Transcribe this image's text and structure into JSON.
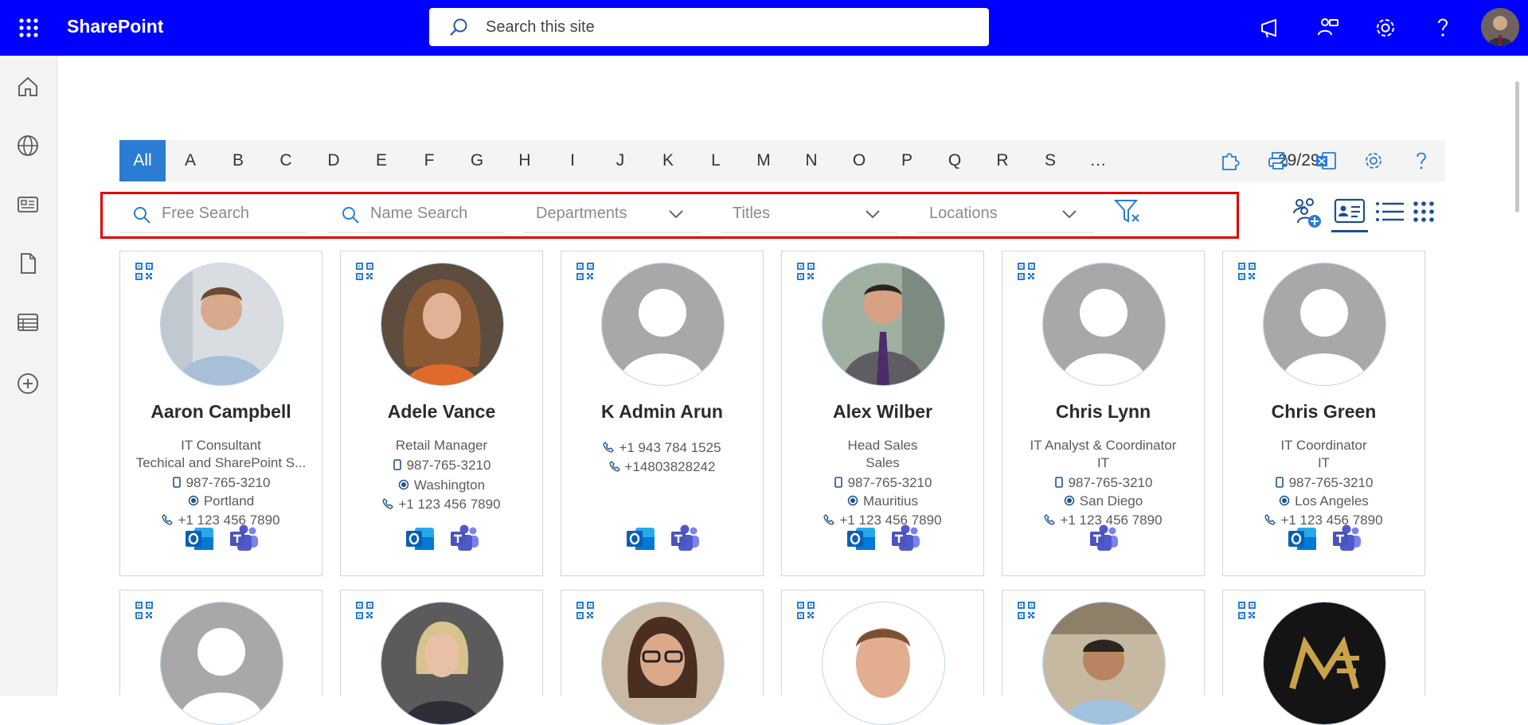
{
  "app": {
    "brand": "SharePoint",
    "search_placeholder": "Search this site"
  },
  "icons": {
    "top": [
      "app-launcher-icon",
      "megaphone-icon",
      "share-icon",
      "settings-icon",
      "help-icon"
    ],
    "rail": [
      "home-icon",
      "globe-icon",
      "news-icon",
      "document-icon",
      "list-icon",
      "add-icon"
    ]
  },
  "alphabet": {
    "letters": [
      "All",
      "A",
      "B",
      "C",
      "D",
      "E",
      "F",
      "G",
      "H",
      "I",
      "J",
      "K",
      "L",
      "M",
      "N",
      "O",
      "P",
      "Q",
      "R",
      "S",
      "…"
    ],
    "active": "All",
    "count": "29/29"
  },
  "filters": {
    "free_search": "Free Search",
    "name_search": "Name Search",
    "departments": "Departments",
    "titles": "Titles",
    "locations": "Locations"
  },
  "colors": {
    "brand_bar": "#0000ff",
    "accent": "#2b7cd3",
    "highlight_border": "#e00000"
  },
  "people": [
    {
      "name": "Aaron Campbell",
      "lines": [
        "IT Consultant",
        "Techical and SharePoint S...",
        "987-765-3210",
        "Portland",
        "+1 123 456 7890"
      ],
      "apps": [
        "outlook",
        "teams"
      ]
    },
    {
      "name": "Adele Vance",
      "lines": [
        "Retail Manager",
        "987-765-3210",
        "Washington",
        "+1 123 456 7890"
      ],
      "apps": [
        "outlook",
        "teams"
      ]
    },
    {
      "name": "K Admin Arun",
      "lines": [
        "+1 943 784 1525",
        "+14803828242"
      ],
      "apps": [
        "outlook",
        "teams"
      ]
    },
    {
      "name": "Alex Wilber",
      "lines": [
        "Head Sales",
        "Sales",
        "987-765-3210",
        "Mauritius",
        "+1 123 456 7890"
      ],
      "apps": [
        "outlook",
        "teams"
      ]
    },
    {
      "name": "Chris Lynn",
      "lines": [
        "IT Analyst & Coordinator",
        "IT",
        "987-765-3210",
        "San Diego",
        "+1 123 456 7890"
      ],
      "apps": [
        "teams"
      ]
    },
    {
      "name": "Chris Green",
      "lines": [
        "IT Coordinator",
        "IT",
        "987-765-3210",
        "Los Angeles",
        "+1 123 456 7890"
      ],
      "apps": [
        "outlook",
        "teams"
      ]
    }
  ]
}
